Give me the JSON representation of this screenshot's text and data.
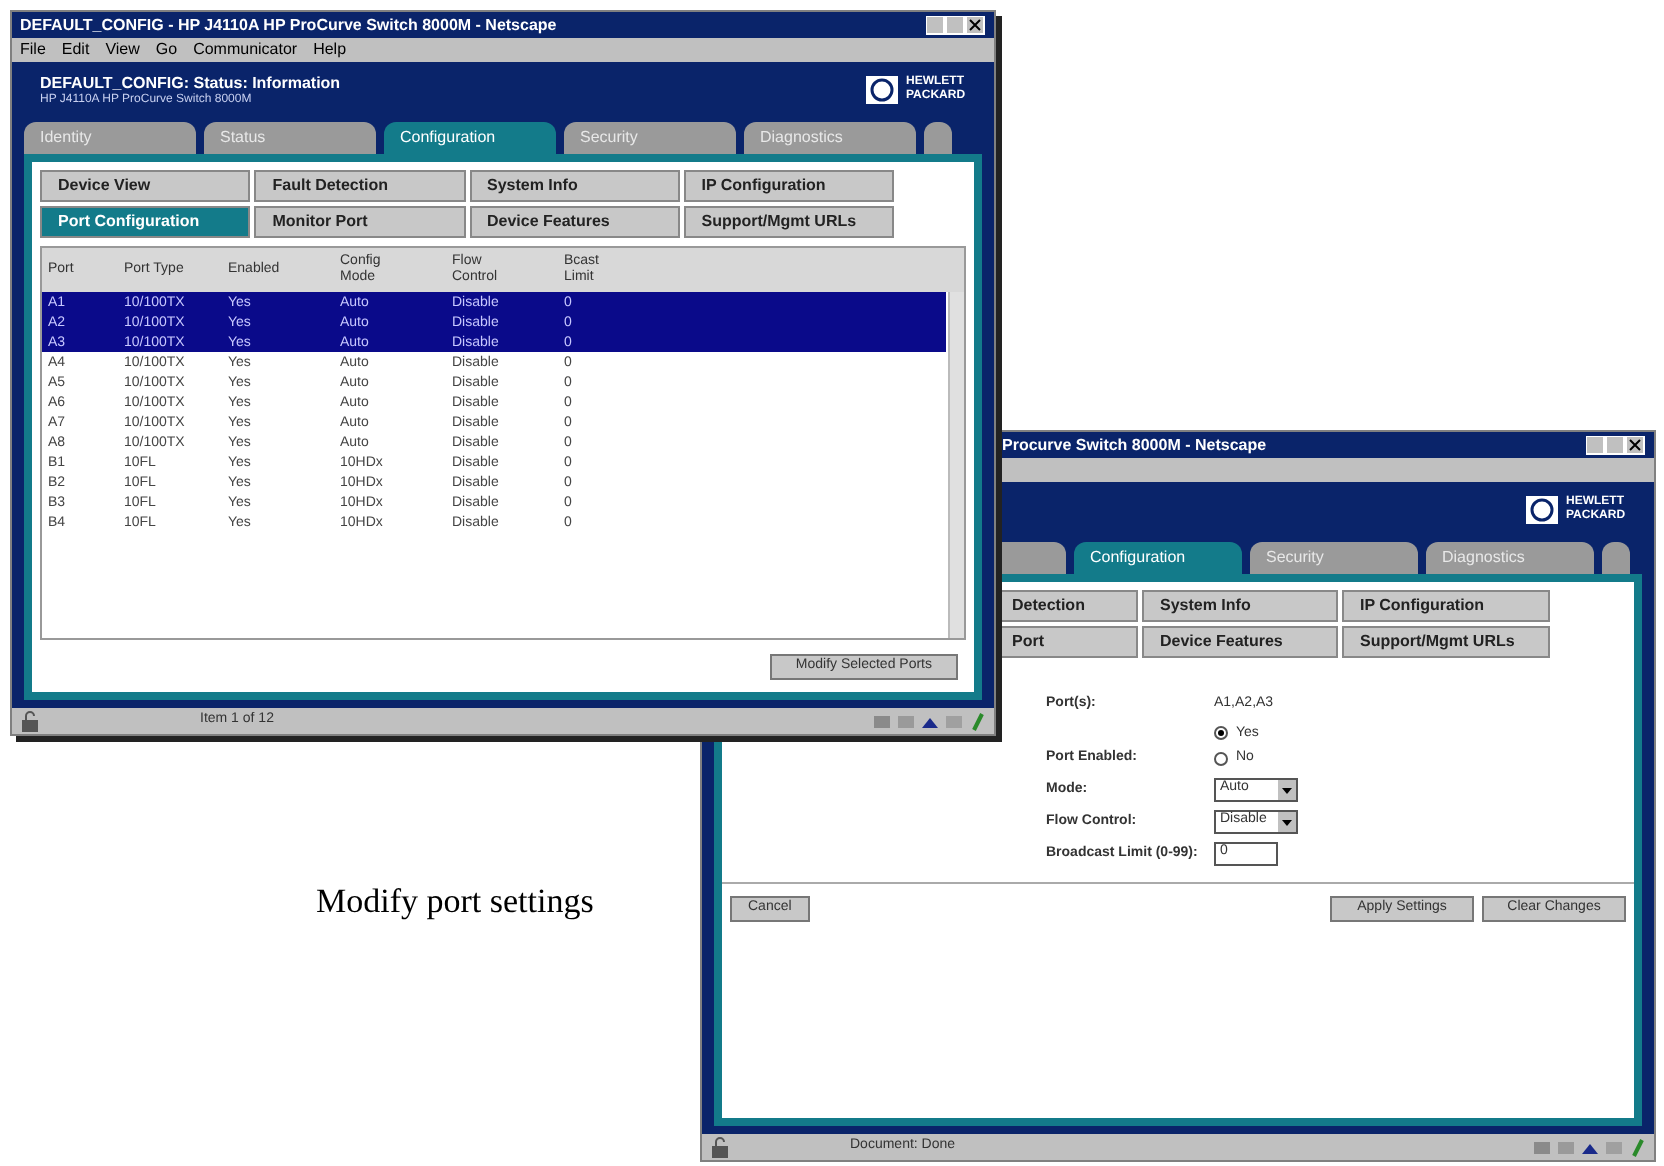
{
  "port_list_window": {
    "title": "DEFAULT_CONFIG - HP J4110A HP ProCurve Switch 8000M - Netscape",
    "menu": [
      "File",
      "Edit",
      "View",
      "Go",
      "Communicator",
      "Help"
    ],
    "header": {
      "title": "DEFAULT_CONFIG: Status: Information",
      "subtitle": "HP J4110A HP ProCurve Switch 8000M",
      "logo_text": "HEWLETT PACKARD"
    },
    "tabs": [
      {
        "label": "Identity",
        "selected": false
      },
      {
        "label": "Status",
        "selected": false
      },
      {
        "label": "Configuration",
        "selected": true
      },
      {
        "label": "Security",
        "selected": false
      },
      {
        "label": "Diagnostics",
        "selected": false
      }
    ],
    "subnav": [
      {
        "label": "Device View",
        "selected": false
      },
      {
        "label": "Fault Detection",
        "selected": false
      },
      {
        "label": "System Info",
        "selected": false
      },
      {
        "label": "IP Configuration",
        "selected": false
      },
      {
        "label": "Port Configuration",
        "selected": true
      },
      {
        "label": "Monitor Port",
        "selected": false
      },
      {
        "label": "Device Features",
        "selected": false
      },
      {
        "label": "Support/Mgmt URLs",
        "selected": false
      }
    ],
    "table": {
      "columns": [
        "Port",
        "Port Type",
        "Enabled",
        "Config Mode",
        "Flow Control",
        "Bcast Limit"
      ],
      "rows": [
        {
          "cells": [
            "A1",
            "10/100TX",
            "Yes",
            "Auto",
            "Disable",
            "0"
          ],
          "selected": true
        },
        {
          "cells": [
            "A2",
            "10/100TX",
            "Yes",
            "Auto",
            "Disable",
            "0"
          ],
          "selected": true
        },
        {
          "cells": [
            "A3",
            "10/100TX",
            "Yes",
            "Auto",
            "Disable",
            "0"
          ],
          "selected": true
        },
        {
          "cells": [
            "A4",
            "10/100TX",
            "Yes",
            "Auto",
            "Disable",
            "0"
          ],
          "selected": false
        },
        {
          "cells": [
            "A5",
            "10/100TX",
            "Yes",
            "Auto",
            "Disable",
            "0"
          ],
          "selected": false
        },
        {
          "cells": [
            "A6",
            "10/100TX",
            "Yes",
            "Auto",
            "Disable",
            "0"
          ],
          "selected": false
        },
        {
          "cells": [
            "A7",
            "10/100TX",
            "Yes",
            "Auto",
            "Disable",
            "0"
          ],
          "selected": false
        },
        {
          "cells": [
            "A8",
            "10/100TX",
            "Yes",
            "Auto",
            "Disable",
            "0"
          ],
          "selected": false
        },
        {
          "cells": [
            "B1",
            "10FL",
            "Yes",
            "10HDx",
            "Disable",
            "0"
          ],
          "selected": false
        },
        {
          "cells": [
            "B2",
            "10FL",
            "Yes",
            "10HDx",
            "Disable",
            "0"
          ],
          "selected": false
        },
        {
          "cells": [
            "B3",
            "10FL",
            "Yes",
            "10HDx",
            "Disable",
            "0"
          ],
          "selected": false
        },
        {
          "cells": [
            "B4",
            "10FL",
            "Yes",
            "10HDx",
            "Disable",
            "0"
          ],
          "selected": false
        }
      ]
    },
    "buttons": [
      "Modify Selected Ports"
    ],
    "status_bar": "Item 1 of 12"
  },
  "port_settings_window": {
    "title": "Procurve Switch 8000M - Netscape",
    "logo_text": "HEWLETT PACKARD",
    "tabs": [
      {
        "label": "Configuration",
        "selected": true
      },
      {
        "label": "Security",
        "selected": false
      },
      {
        "label": "Diagnostics",
        "selected": false
      }
    ],
    "subnav": [
      {
        "label": "Detection",
        "selected": false
      },
      {
        "label": "System Info",
        "selected": false
      },
      {
        "label": "IP Configuration",
        "selected": false
      },
      {
        "label": "Port",
        "selected": false
      },
      {
        "label": "Device Features",
        "selected": false
      },
      {
        "label": "Support/Mgmt URLs",
        "selected": false
      }
    ],
    "form": [
      {
        "kind": "text",
        "label": "Port(s):",
        "value": "A1,A2,A3"
      },
      {
        "kind": "radio",
        "label": "Port Enabled:",
        "options": [
          {
            "label": "Yes",
            "selected": true
          },
          {
            "label": "No",
            "selected": false
          }
        ]
      },
      {
        "kind": "select",
        "label": "Mode:",
        "value": "Auto"
      },
      {
        "kind": "select",
        "label": "Flow Control:",
        "value": "Disable"
      },
      {
        "kind": "input",
        "label": "Broadcast Limit (0-99):",
        "value": "0"
      }
    ],
    "cancel_button": "Cancel",
    "buttons": [
      "Apply Settings",
      "Clear Changes"
    ],
    "status_bar": "Document: Done"
  },
  "caption": "Modify port settings"
}
